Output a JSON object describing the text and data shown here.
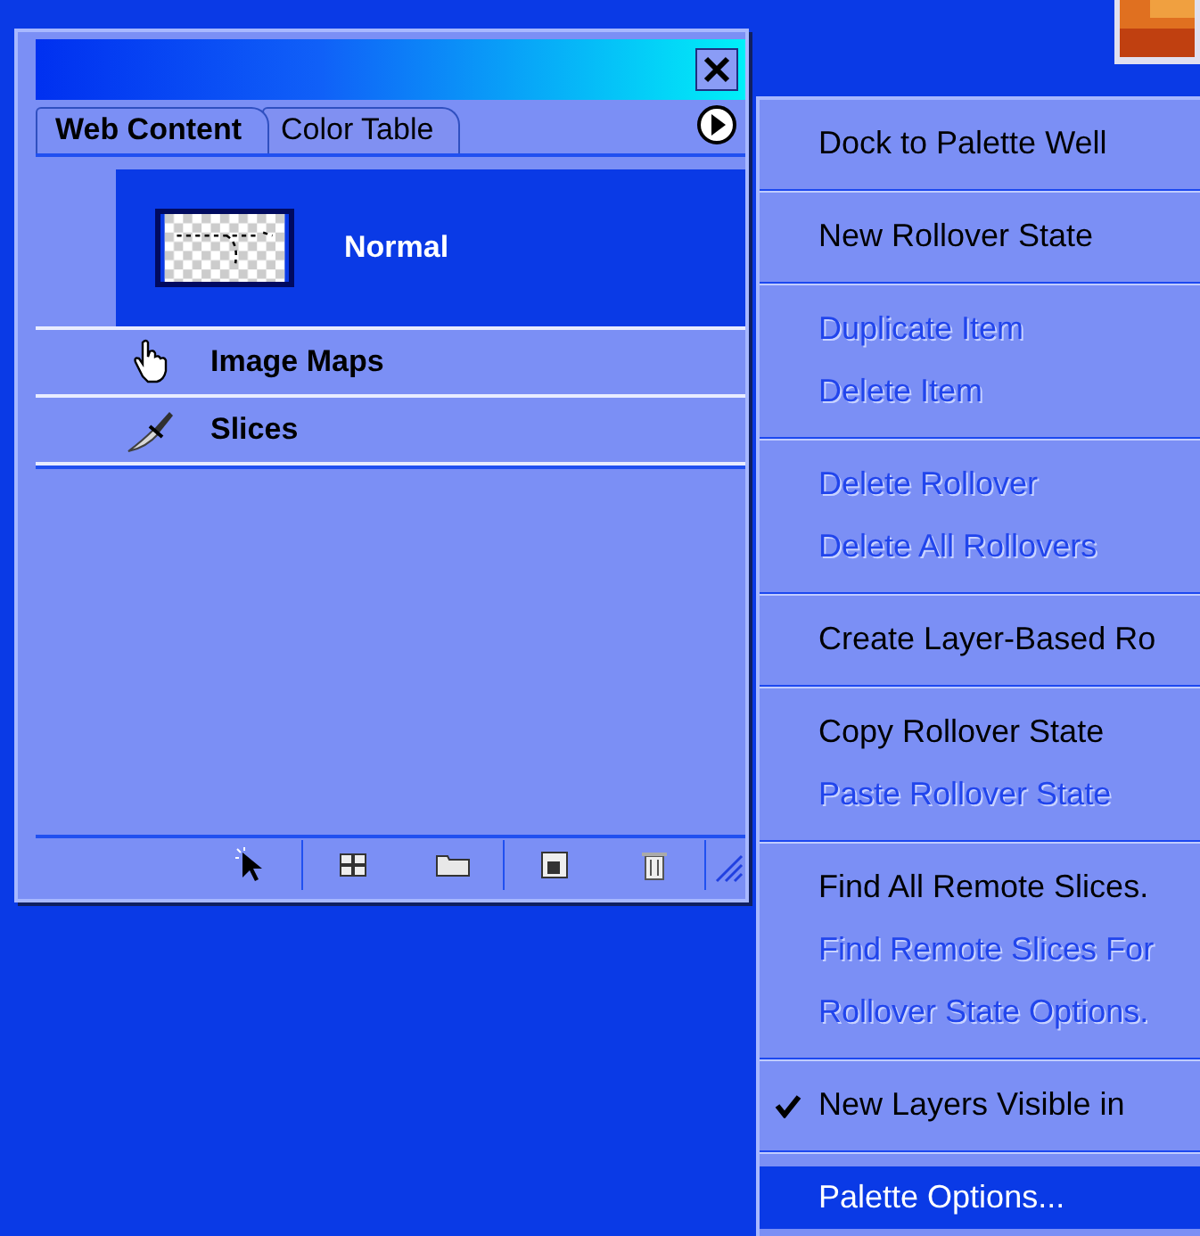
{
  "palette": {
    "tabs": [
      {
        "label": "Web Content",
        "selected": true
      },
      {
        "label": "Color Table",
        "selected": false
      }
    ],
    "rows": [
      {
        "kind": "state",
        "label": "Normal",
        "selected": true
      },
      {
        "kind": "image-maps",
        "label": "Image Maps",
        "selected": false
      },
      {
        "kind": "slices",
        "label": "Slices",
        "selected": false
      }
    ]
  },
  "menu": {
    "groups": [
      [
        {
          "label": "Dock to Palette Well",
          "disabled": false,
          "checked": false,
          "selected": false
        }
      ],
      [
        {
          "label": "New Rollover State",
          "disabled": false,
          "checked": false,
          "selected": false
        }
      ],
      [
        {
          "label": "Duplicate Item",
          "disabled": true,
          "checked": false,
          "selected": false
        },
        {
          "label": "Delete Item",
          "disabled": true,
          "checked": false,
          "selected": false
        }
      ],
      [
        {
          "label": "Delete Rollover",
          "disabled": true,
          "checked": false,
          "selected": false
        },
        {
          "label": "Delete All Rollovers",
          "disabled": true,
          "checked": false,
          "selected": false
        }
      ],
      [
        {
          "label": "Create Layer-Based Ro",
          "disabled": false,
          "checked": false,
          "selected": false
        }
      ],
      [
        {
          "label": "Copy Rollover State",
          "disabled": false,
          "checked": false,
          "selected": false
        },
        {
          "label": "Paste Rollover State",
          "disabled": true,
          "checked": false,
          "selected": false
        }
      ],
      [
        {
          "label": "Find All Remote Slices.",
          "disabled": false,
          "checked": false,
          "selected": false
        },
        {
          "label": "Find Remote Slices For",
          "disabled": true,
          "checked": false,
          "selected": false
        },
        {
          "label": "Rollover State Options.",
          "disabled": true,
          "checked": false,
          "selected": false
        }
      ],
      [
        {
          "label": "New Layers Visible in",
          "disabled": false,
          "checked": true,
          "selected": false
        }
      ],
      [
        {
          "label": "Palette Options...",
          "disabled": false,
          "checked": false,
          "selected": true
        }
      ]
    ]
  }
}
